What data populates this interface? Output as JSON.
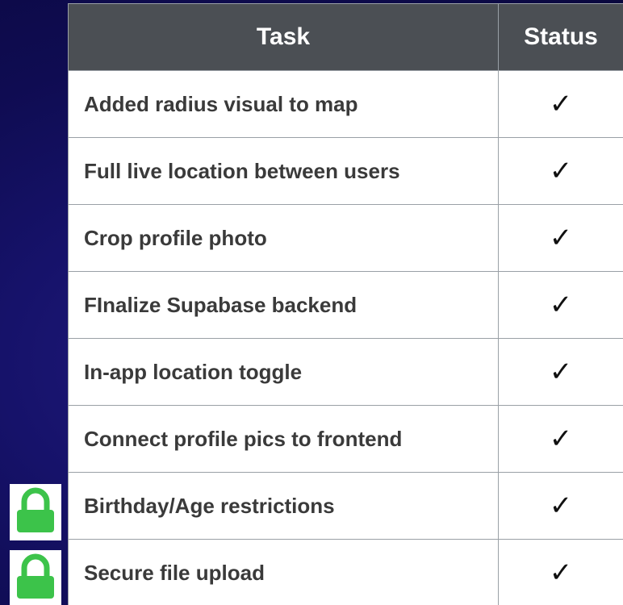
{
  "table": {
    "headers": {
      "task": "Task",
      "status": "Status"
    },
    "rows": [
      {
        "task": "Added radius visual to map",
        "status": "✓"
      },
      {
        "task": "Full live location between users",
        "status": "✓"
      },
      {
        "task": "Crop profile photo",
        "status": "✓"
      },
      {
        "task": "FInalize Supabase backend",
        "status": "✓"
      },
      {
        "task": "In-app location toggle",
        "status": "✓"
      },
      {
        "task": "Connect profile pics to frontend",
        "status": "✓"
      },
      {
        "task": "Birthday/Age restrictions",
        "status": "✓"
      },
      {
        "task": "Secure file upload",
        "status": "✓"
      }
    ]
  },
  "icons": {
    "lock": "lock-icon",
    "lock_color": "#3cc34a"
  }
}
